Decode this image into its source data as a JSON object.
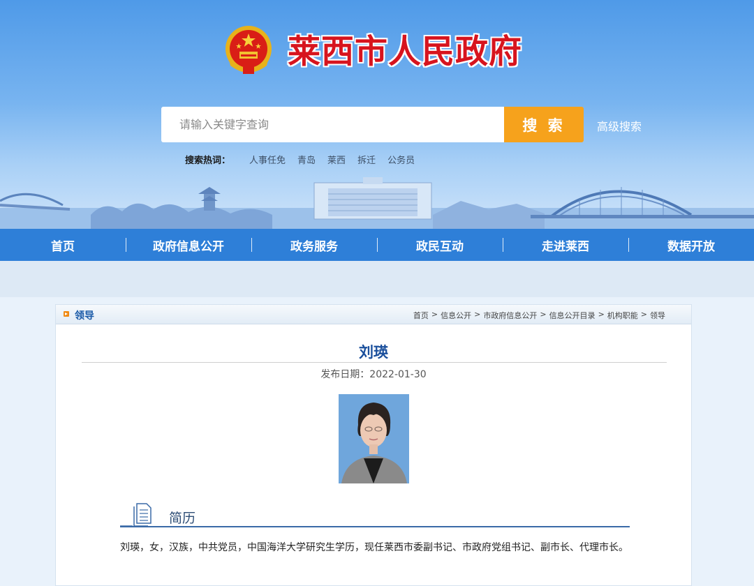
{
  "header": {
    "site_title": "莱西市人民政府",
    "emblem_icon": "national-emblem-icon",
    "search": {
      "placeholder": "请输入关键字查询",
      "button_label": "搜 索",
      "advanced_label": "高级搜索"
    },
    "hot_words": {
      "label": "搜索热词：",
      "items": [
        "人事任免",
        "青岛",
        "莱西",
        "拆迁",
        "公务员"
      ]
    }
  },
  "nav": {
    "items": [
      "首页",
      "政府信息公开",
      "政务服务",
      "政民互动",
      "走进莱西",
      "数据开放"
    ]
  },
  "section": {
    "title": "领导",
    "breadcrumb": [
      "首页",
      "信息公开",
      "市政府信息公开",
      "信息公开目录",
      "机构职能",
      "领导"
    ],
    "separator": ">"
  },
  "article": {
    "name": "刘瑛",
    "publish_date": "发布日期：2022-01-30",
    "photo_icon": "portrait-photo",
    "resume_title": "简历",
    "resume_text": "刘瑛，女，汉族，中共党员，中国海洋大学研究生学历，现任莱西市委副书记、市政府党组书记、副市长、代理市长。"
  },
  "colors": {
    "header_top": "#4f9ae8",
    "nav_bg": "#2e7fd8",
    "search_button": "#f6a21c",
    "title_red": "#d7141e",
    "name_blue": "#1a4f9c"
  }
}
